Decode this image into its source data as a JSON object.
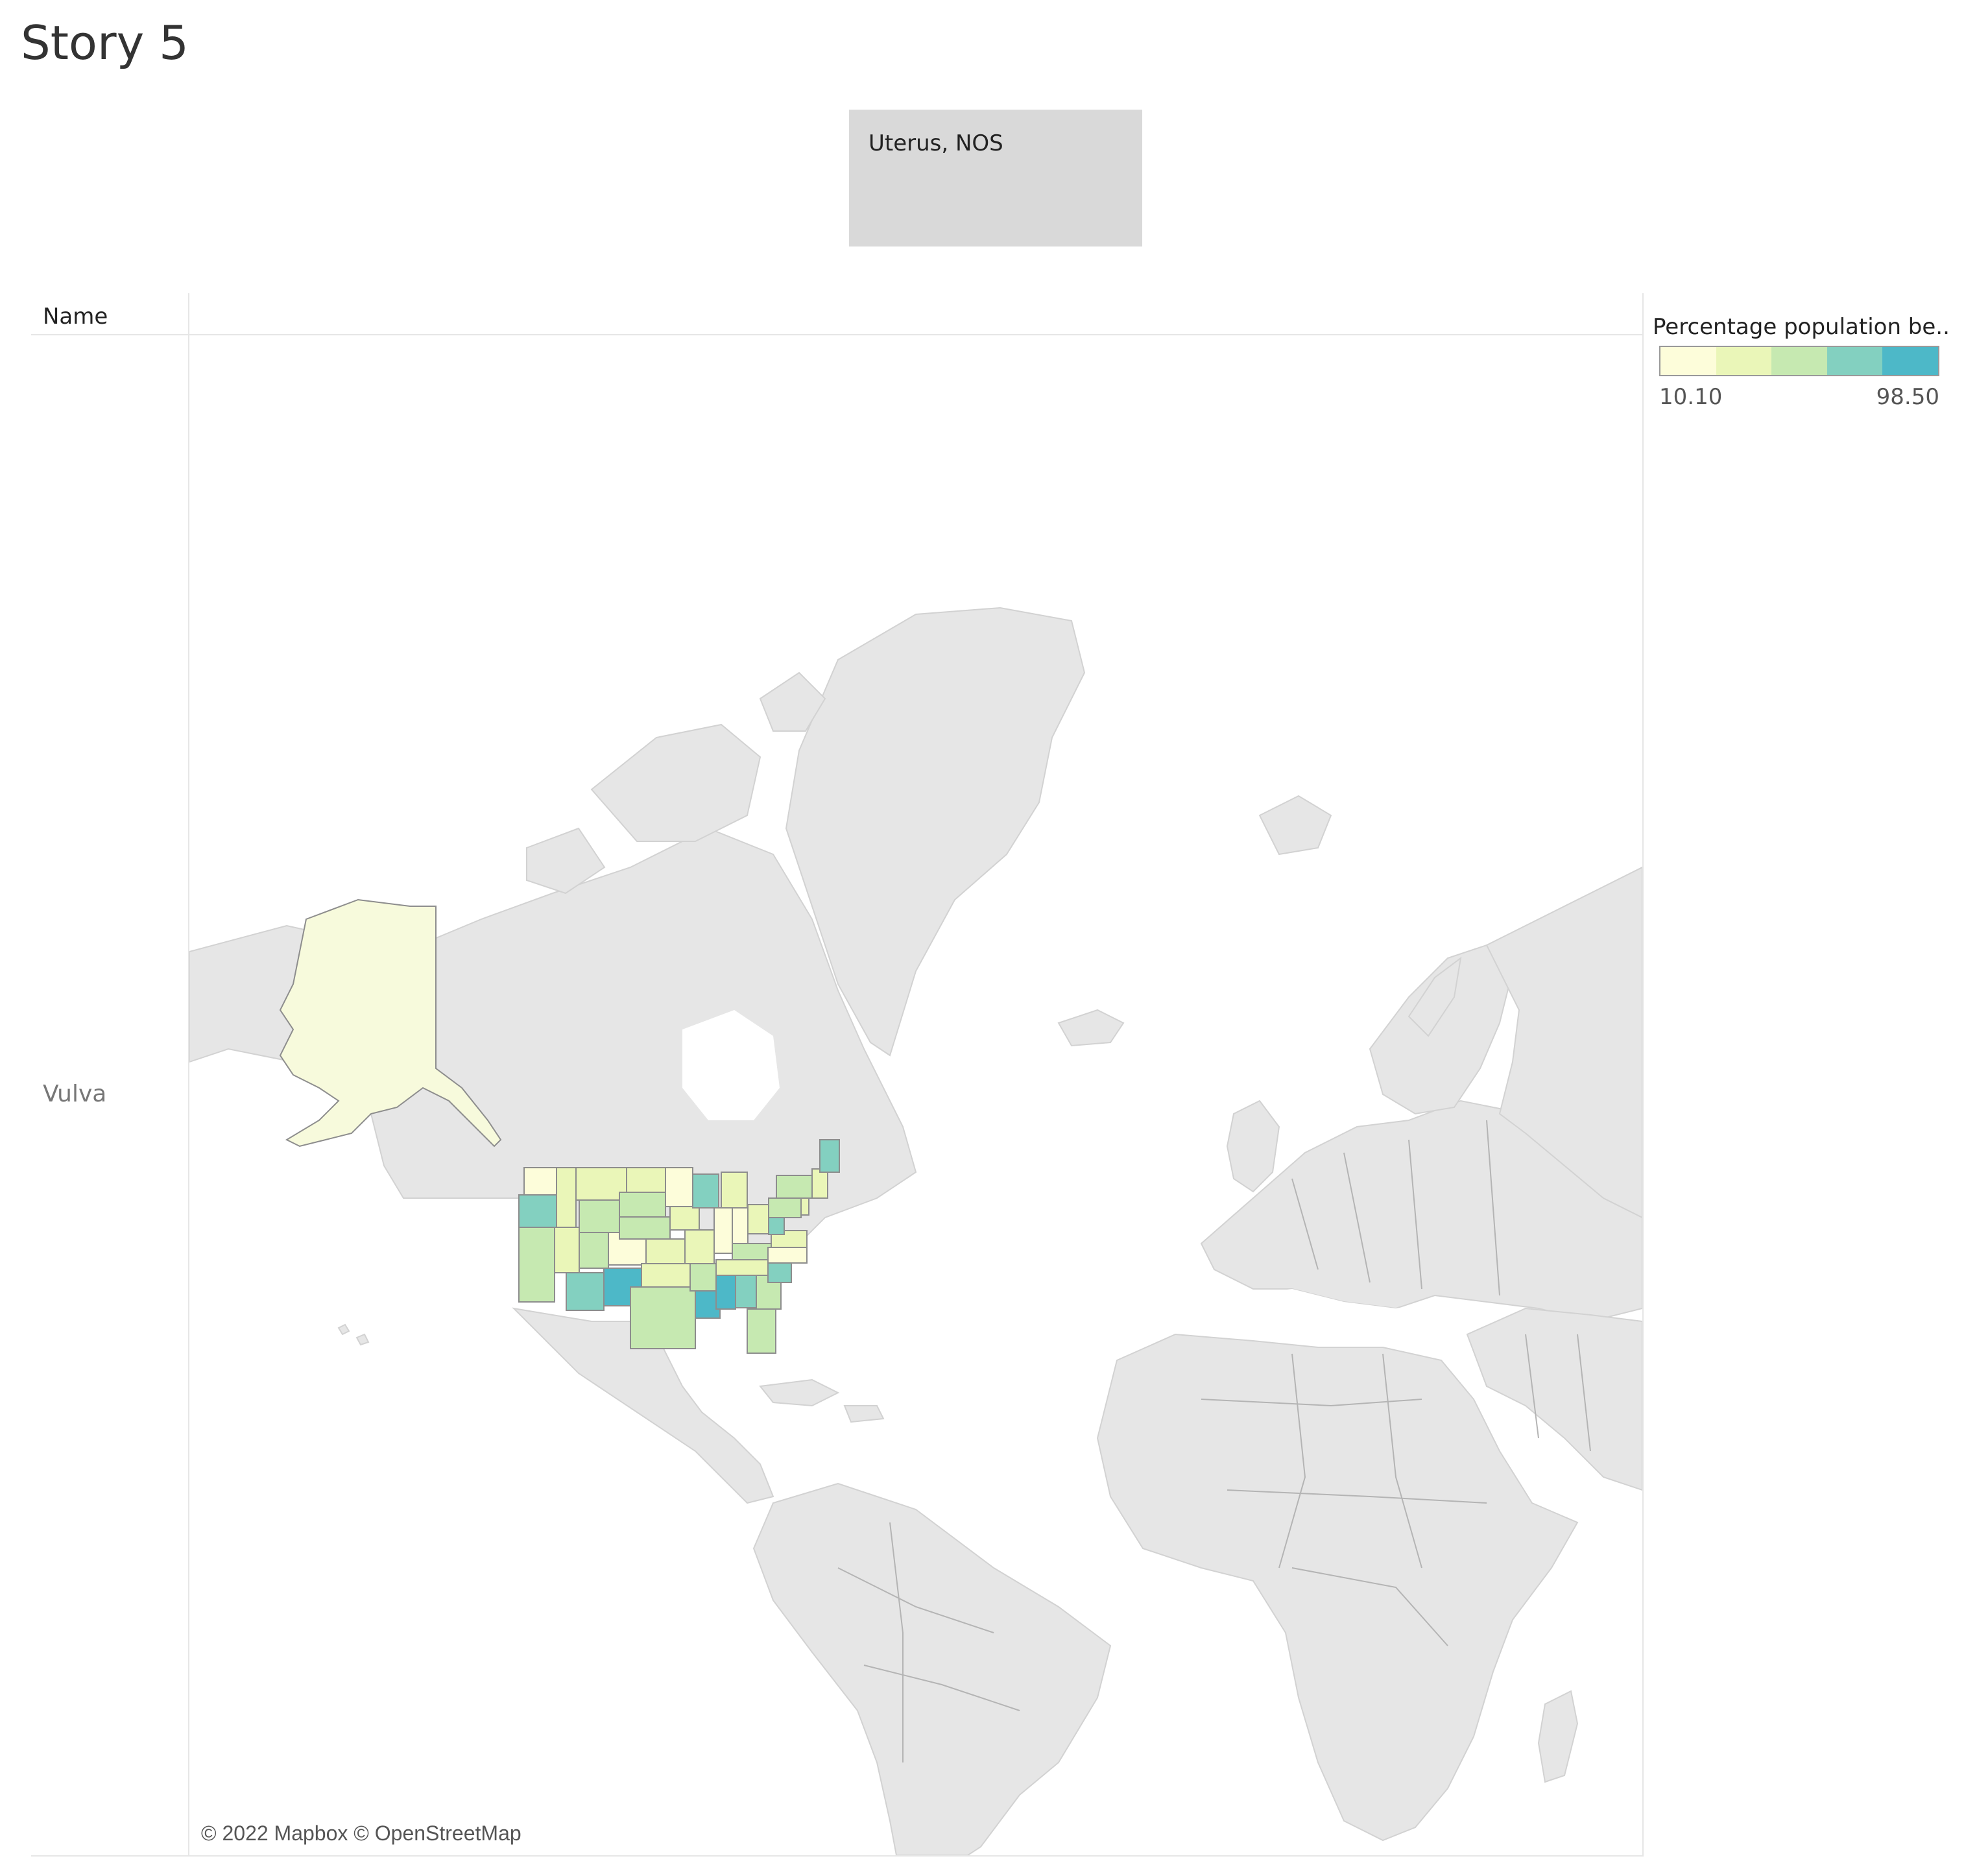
{
  "story": {
    "title": "Story 5"
  },
  "story_point": {
    "caption": "Uterus, NOS"
  },
  "table": {
    "column_header": "Name",
    "row_label": "Vulva"
  },
  "legend": {
    "title": "Percentage population be..",
    "min": "10.10",
    "max": "98.50",
    "colors": [
      "#fdfdda",
      "#eaf6b8",
      "#c6e9b1",
      "#83d0c0",
      "#4db8c8"
    ]
  },
  "map": {
    "attribution": "© 2022 Mapbox © OpenStreetMap",
    "land_color": "#e8e8e8",
    "water_color": "#ffffff",
    "border_color": "#9b9b9b"
  }
}
